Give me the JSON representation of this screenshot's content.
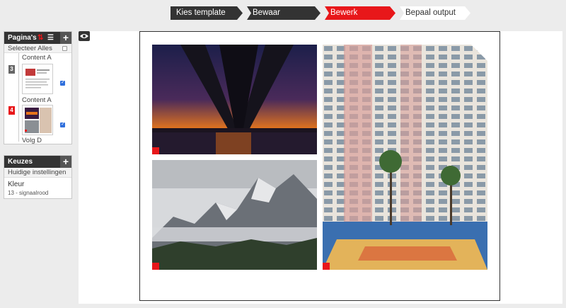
{
  "stepper": {
    "steps": [
      {
        "label": "Kies template"
      },
      {
        "label": "Bewaar document"
      },
      {
        "label": "Bewerk document"
      },
      {
        "label": "Bepaal output"
      }
    ]
  },
  "pages_panel": {
    "title": "Pagina's",
    "select_all": "Selecteer Alles",
    "items": [
      {
        "top_label": "Content A",
        "number": "3",
        "bottom_label": "Content A",
        "checked": true
      },
      {
        "number": "4",
        "bottom_label": "Volg D",
        "checked": true
      }
    ]
  },
  "choices_panel": {
    "title": "Keuzes",
    "current_settings": "Huidige instellingen",
    "color_label": "Kleur",
    "color_value": "13 - signaalrood"
  },
  "colors": {
    "accent": "#e8171a",
    "dark": "#333333"
  }
}
